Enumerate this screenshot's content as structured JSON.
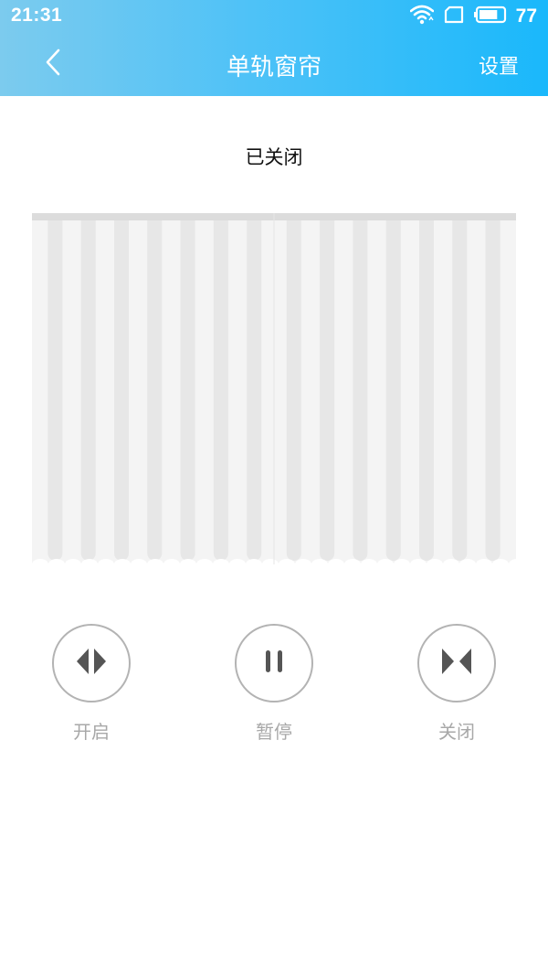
{
  "status_bar": {
    "time": "21:31",
    "battery": "77",
    "icons": [
      "wifi-icon",
      "sim-card-icon",
      "battery-icon"
    ]
  },
  "nav": {
    "title": "单轨窗帘",
    "settings_label": "设置",
    "back_icon": "chevron-left-icon"
  },
  "curtain": {
    "state": "已关闭",
    "open_fraction": 0
  },
  "controls": [
    {
      "label": "开启",
      "icon": "open-arrows-icon"
    },
    {
      "label": "暂停",
      "icon": "pause-icon"
    },
    {
      "label": "关闭",
      "icon": "close-arrows-icon"
    }
  ],
  "colors": {
    "header_start": "#7ccbee",
    "header_end": "#1ab8fb",
    "button_border": "#b3b3b3",
    "label": "#a8a8a8",
    "icon": "#555555"
  }
}
